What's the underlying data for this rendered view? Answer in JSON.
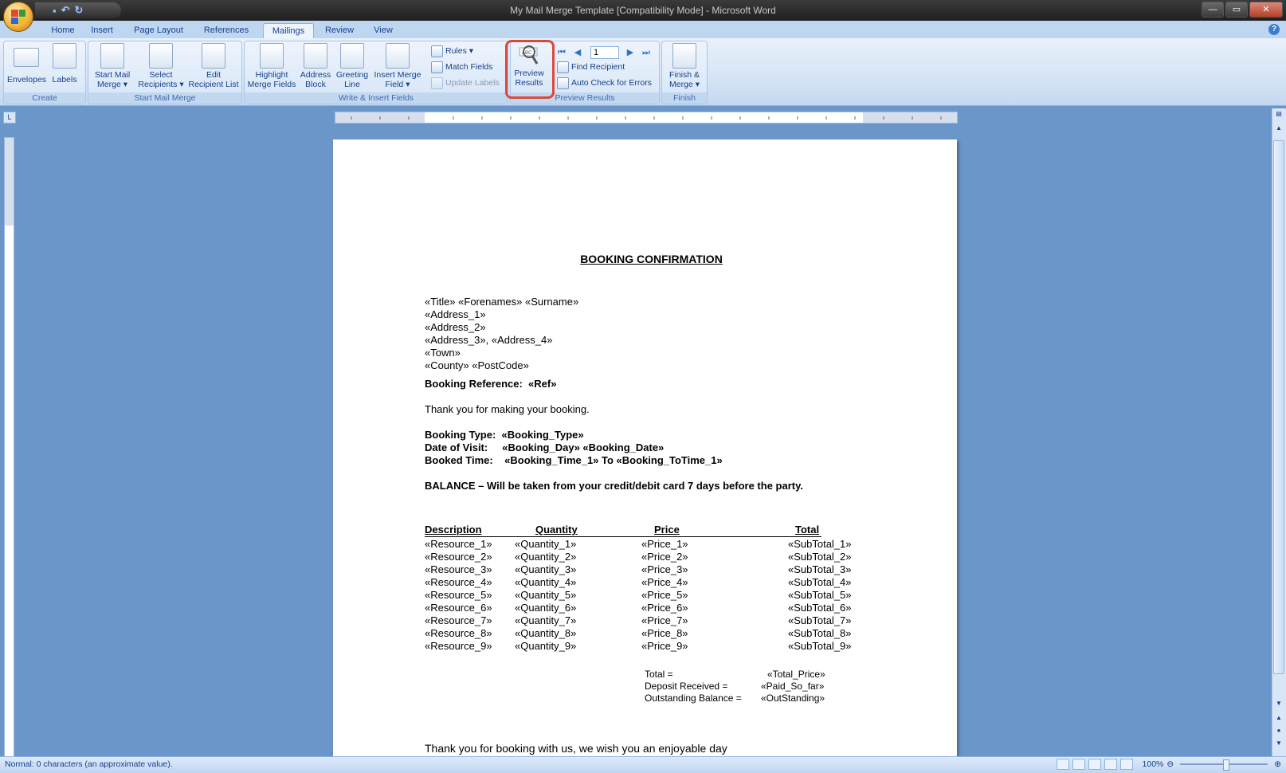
{
  "window": {
    "title": "My Mail Merge Template [Compatibility Mode] - Microsoft Word",
    "controls": [
      "—",
      "▭",
      "✕"
    ]
  },
  "tabs": [
    {
      "label": "Home"
    },
    {
      "label": "Insert"
    },
    {
      "label": "Page Layout"
    },
    {
      "label": "References"
    },
    {
      "label": "Mailings"
    },
    {
      "label": "Review"
    },
    {
      "label": "View"
    }
  ],
  "active_tab": "Mailings",
  "ribbon": {
    "create": {
      "label": "Create",
      "envelopes": "Envelopes",
      "labels": "Labels"
    },
    "start_mail_merge": {
      "label": "Start Mail Merge",
      "start_l1": "Start Mail",
      "start_l2": "Merge ▾",
      "select_l1": "Select",
      "select_l2": "Recipients ▾",
      "edit_l1": "Edit",
      "edit_l2": "Recipient List"
    },
    "write_insert": {
      "label": "Write & Insert Fields",
      "highlight_l1": "Highlight",
      "highlight_l2": "Merge Fields",
      "address_l1": "Address",
      "address_l2": "Block",
      "greeting_l1": "Greeting",
      "greeting_l2": "Line",
      "insert_l1": "Insert Merge",
      "insert_l2": "Field ▾",
      "rules": "Rules ▾",
      "match_fields": "Match Fields",
      "update_labels": "Update Labels"
    },
    "preview": {
      "label": "Preview Results",
      "preview_l1": "Preview",
      "preview_l2": "Results",
      "record": "1",
      "find_recipient": "Find Recipient",
      "auto_check": "Auto Check for Errors"
    },
    "finish": {
      "label": "Finish",
      "finish_l1": "Finish &",
      "finish_l2": "Merge ▾"
    }
  },
  "document": {
    "title": "BOOKING CONFIRMATION",
    "address_lines": [
      "«Title» «Forenames» «Surname»",
      "«Address_1»",
      "«Address_2»",
      "«Address_3», «Address_4»",
      "«Town»",
      "«County» «PostCode»"
    ],
    "booking_reference": "Booking Reference:  «Ref»",
    "thank_you": "Thank you for making your booking.",
    "booking_type": "Booking Type:  «Booking_Type»",
    "date_of_visit": "Date of Visit:     «Booking_Day» «Booking_Date»",
    "booked_time": "Booked Time:    «Booking_Time_1» To «Booking_ToTime_1»",
    "balance_note": "BALANCE – Will be taken from your credit/debit card 7 days before the party.",
    "table": {
      "headers": [
        "Description",
        "Quantity",
        "Price",
        "Total"
      ],
      "rows": [
        [
          "«Resource_1»",
          "«Quantity_1»",
          "«Price_1»",
          "«SubTotal_1»"
        ],
        [
          "«Resource_2»",
          "«Quantity_2»",
          "«Price_2»",
          "«SubTotal_2»"
        ],
        [
          "«Resource_3»",
          "«Quantity_3»",
          "«Price_3»",
          "«SubTotal_3»"
        ],
        [
          "«Resource_4»",
          "«Quantity_4»",
          "«Price_4»",
          "«SubTotal_4»"
        ],
        [
          "«Resource_5»",
          "«Quantity_5»",
          "«Price_5»",
          "«SubTotal_5»"
        ],
        [
          "«Resource_6»",
          "«Quantity_6»",
          "«Price_6»",
          "«SubTotal_6»"
        ],
        [
          "«Resource_7»",
          "«Quantity_7»",
          "«Price_7»",
          "«SubTotal_7»"
        ],
        [
          "«Resource_8»",
          "«Quantity_8»",
          "«Price_8»",
          "«SubTotal_8»"
        ],
        [
          "«Resource_9»",
          "«Quantity_9»",
          "«Price_9»",
          "«SubTotal_9»"
        ]
      ]
    },
    "totals": [
      {
        "label": "Total =",
        "value": "«Total_Price»"
      },
      {
        "label": "Deposit Received =",
        "value": "«Paid_So_far»"
      },
      {
        "label": "Outstanding Balance =",
        "value": "«OutStanding»"
      }
    ],
    "closing": "Thank you for booking with us, we wish you an enjoyable day"
  },
  "statusbar": {
    "text": "Normal: 0 characters (an approximate value).",
    "zoom": "100%"
  },
  "colors": {
    "accent": "#15428b",
    "highlight": "#d94a3a",
    "background": "#6b96c9"
  }
}
